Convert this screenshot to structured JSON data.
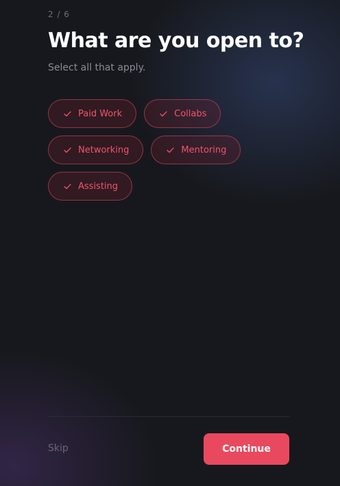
{
  "progress": {
    "label": "2 / 6",
    "current": 2,
    "total": 6
  },
  "header": {
    "title": "What are you open to?",
    "subtitle": "Select all that apply."
  },
  "options": [
    {
      "label": "Paid Work",
      "selected": true,
      "icon": "check-icon"
    },
    {
      "label": "Collabs",
      "selected": true,
      "icon": "check-icon"
    },
    {
      "label": "Networking",
      "selected": true,
      "icon": "check-icon"
    },
    {
      "label": "Mentoring",
      "selected": true,
      "icon": "check-icon"
    },
    {
      "label": "Assisting",
      "selected": true,
      "icon": "check-icon"
    }
  ],
  "footer": {
    "skip_label": "Skip",
    "continue_label": "Continue"
  },
  "colors": {
    "accent": "#e9495f",
    "chip_text": "#f0546e",
    "background": "#17181d"
  }
}
